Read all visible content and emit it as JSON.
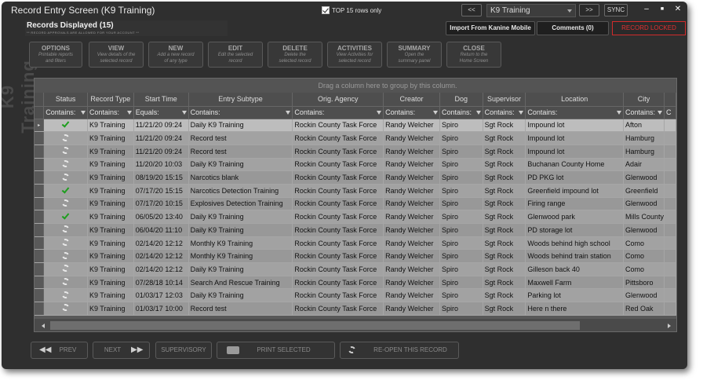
{
  "window": {
    "title": "Record Entry Screen (K9 Training)",
    "top_rows_label": "TOP 15 rows only",
    "prev_nav": "<<",
    "next_nav": ">>",
    "record_type_selected": "K9 Training",
    "sync_label": "SYNC",
    "minimize": "–",
    "maximize": "■",
    "close": "✕"
  },
  "records": {
    "title": "Records Displayed (15)",
    "subtitle": "** RECORD APPROVALS ARE ALLOWED FOR YOUR ACCOUNT **"
  },
  "actions": {
    "import": "Import From Kanine Mobile",
    "comments": "Comments (0)",
    "locked": "RECORD LOCKED"
  },
  "side_title": "K9 Training",
  "toolbar": [
    {
      "label": "OPTIONS",
      "desc1": "Printable reports",
      "desc2": "and filters"
    },
    {
      "label": "VIEW",
      "desc1": "View details of the",
      "desc2": "selected record"
    },
    {
      "label": "NEW",
      "desc1": "Add a new record",
      "desc2": "of any type"
    },
    {
      "label": "EDIT",
      "desc1": "Edit the selected",
      "desc2": "record"
    },
    {
      "label": "DELETE",
      "desc1": "Delete the",
      "desc2": "selected record"
    },
    {
      "label": "ACTIVITIES",
      "desc1": "View Activities for",
      "desc2": "selected record"
    },
    {
      "label": "SUMMARY",
      "desc1": "Open the",
      "desc2": "summary panel"
    },
    {
      "label": "CLOSE",
      "desc1": "Return to the",
      "desc2": "Home Screen"
    }
  ],
  "grid": {
    "drag_hint": "Drag a column here to group by this column.",
    "columns": [
      "Status",
      "Record Type",
      "Start Time",
      "Entry Subtype",
      "Orig. Agency",
      "Creator",
      "Dog",
      "Supervisor",
      "Location",
      "City"
    ],
    "filters": [
      "Contains:",
      "Contains:",
      "Equals:",
      "Contains:",
      "Contains:",
      "Contains:",
      "Contains:",
      "Contains:",
      "Contains:",
      "Contains:",
      "C"
    ],
    "current_row_marker": "▸",
    "rows": [
      {
        "status": "check",
        "type": "K9 Training",
        "start": "11/21/20 09:24",
        "subtype": "Daily K9 Training",
        "agency": "Rockin County Task Force",
        "creator": "Randy Welcher",
        "dog": "Spiro",
        "supervisor": "Sgt Rock",
        "location": "Impound lot",
        "city": "Afton"
      },
      {
        "status": "sync",
        "type": "K9 Training",
        "start": "11/21/20 09:24",
        "subtype": "Record test",
        "agency": "Rockin County Task Force",
        "creator": "Randy Welcher",
        "dog": "Spiro",
        "supervisor": "Sgt Rock",
        "location": "Impound lot",
        "city": "Hamburg"
      },
      {
        "status": "sync",
        "type": "K9 Training",
        "start": "11/21/20 09:24",
        "subtype": "Record test",
        "agency": "Rockin County Task Force",
        "creator": "Randy Welcher",
        "dog": "Spiro",
        "supervisor": "Sgt Rock",
        "location": "Impound lot",
        "city": "Hamburg"
      },
      {
        "status": "sync",
        "type": "K9 Training",
        "start": "11/20/20 10:03",
        "subtype": "Daily K9 Training",
        "agency": "Rockin County Task Force",
        "creator": "Randy Welcher",
        "dog": "Spiro",
        "supervisor": "Sgt Rock",
        "location": "Buchanan County Home",
        "city": "Adair"
      },
      {
        "status": "sync",
        "type": "K9 Training",
        "start": "08/19/20 15:15",
        "subtype": "Narcotics blank",
        "agency": "Rockin County Task Force",
        "creator": "Randy Welcher",
        "dog": "Spiro",
        "supervisor": "Sgt Rock",
        "location": "PD PKG lot",
        "city": "Glenwood"
      },
      {
        "status": "check",
        "type": "K9 Training",
        "start": "07/17/20 15:15",
        "subtype": "Narcotics Detection Training",
        "agency": "Rockin County Task Force",
        "creator": "Randy Welcher",
        "dog": "Spiro",
        "supervisor": "Sgt Rock",
        "location": "Greenfield impound lot",
        "city": "Greenfield"
      },
      {
        "status": "sync",
        "type": "K9 Training",
        "start": "07/17/20 10:15",
        "subtype": "Explosives Detection Training",
        "agency": "Rockin County Task Force",
        "creator": "Randy Welcher",
        "dog": "Spiro",
        "supervisor": "Sgt Rock",
        "location": "Firing range",
        "city": "Glenwood"
      },
      {
        "status": "check",
        "type": "K9 Training",
        "start": "06/05/20 13:40",
        "subtype": "Daily K9 Training",
        "agency": "Rockin County Task Force",
        "creator": "Randy Welcher",
        "dog": "Spiro",
        "supervisor": "Sgt Rock",
        "location": "Glenwood park",
        "city": "Mills County"
      },
      {
        "status": "sync",
        "type": "K9 Training",
        "start": "06/04/20 11:10",
        "subtype": "Daily K9 Training",
        "agency": "Rockin County Task Force",
        "creator": "Randy Welcher",
        "dog": "Spiro",
        "supervisor": "Sgt Rock",
        "location": "PD storage lot",
        "city": "Glenwood"
      },
      {
        "status": "sync",
        "type": "K9 Training",
        "start": "02/14/20 12:12",
        "subtype": "Monthly K9 Training",
        "agency": "Rockin County Task Force",
        "creator": "Randy Welcher",
        "dog": "Spiro",
        "supervisor": "Sgt Rock",
        "location": "Woods behind high school",
        "city": "Como"
      },
      {
        "status": "sync",
        "type": "K9 Training",
        "start": "02/14/20 12:12",
        "subtype": "Monthly K9 Training",
        "agency": "Rockin County Task Force",
        "creator": "Randy Welcher",
        "dog": "Spiro",
        "supervisor": "Sgt Rock",
        "location": "Woods behind train station",
        "city": "Como"
      },
      {
        "status": "sync",
        "type": "K9 Training",
        "start": "02/14/20 12:12",
        "subtype": "Daily K9 Training",
        "agency": "Rockin County Task Force",
        "creator": "Randy Welcher",
        "dog": "Spiro",
        "supervisor": "Sgt Rock",
        "location": "Gilleson back 40",
        "city": "Como"
      },
      {
        "status": "sync",
        "type": "K9 Training",
        "start": "07/28/18 10:14",
        "subtype": "Search And Rescue Training",
        "agency": "Rockin County Task Force",
        "creator": "Randy Welcher",
        "dog": "Spiro",
        "supervisor": "Sgt Rock",
        "location": "Maxwell Farm",
        "city": "Pittsboro"
      },
      {
        "status": "sync",
        "type": "K9 Training",
        "start": "01/03/17 12:03",
        "subtype": "Daily K9 Training",
        "agency": "Rockin County Task Force",
        "creator": "Randy Welcher",
        "dog": "Spiro",
        "supervisor": "Sgt Rock",
        "location": "Parking lot",
        "city": "Glenwood"
      },
      {
        "status": "sync",
        "type": "K9 Training",
        "start": "01/03/17 10:00",
        "subtype": "Record test",
        "agency": "Rockin County Task Force",
        "creator": "Randy Welcher",
        "dog": "Spiro",
        "supervisor": "Sgt Rock",
        "location": "Here n there",
        "city": "Red Oak"
      }
    ]
  },
  "bottom": {
    "prev": "PREV",
    "next": "NEXT",
    "supervisory": "SUPERVISORY",
    "print": "PRINT SELECTED",
    "reopen": "RE-OPEN THIS RECORD"
  },
  "colors": {
    "window_bg": "#2f2f2f",
    "locked_red": "#e03030",
    "status_green": "#1e9e1e"
  }
}
